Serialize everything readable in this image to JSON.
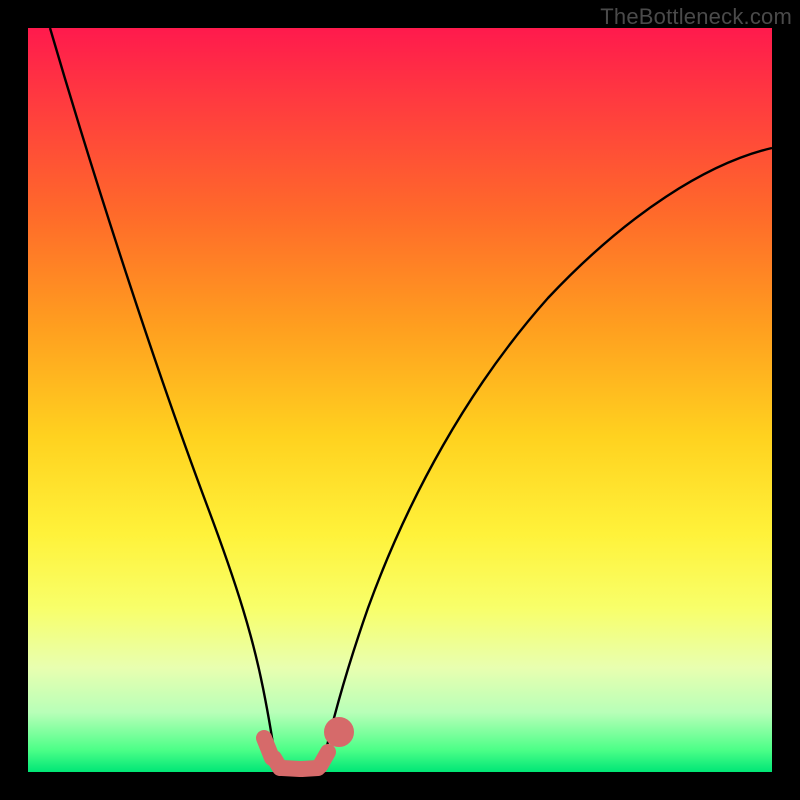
{
  "watermark": "TheBottleneck.com",
  "chart_data": {
    "type": "line",
    "title": "",
    "xlabel": "",
    "ylabel": "",
    "xlim": [
      0,
      100
    ],
    "ylim": [
      0,
      100
    ],
    "grid": false,
    "legend": false,
    "series": [
      {
        "name": "left-branch",
        "x": [
          3,
          6,
          10,
          14,
          18,
          22,
          25,
          27,
          29,
          31,
          32.5
        ],
        "y": [
          100,
          84,
          66,
          50,
          36,
          22,
          12,
          6,
          2.5,
          0.8,
          0
        ]
      },
      {
        "name": "valley-floor",
        "x": [
          32.5,
          34,
          36,
          38,
          39.5
        ],
        "y": [
          0,
          0,
          0,
          0,
          0
        ]
      },
      {
        "name": "right-branch",
        "x": [
          39.5,
          41,
          44,
          48,
          54,
          62,
          72,
          84,
          96,
          100
        ],
        "y": [
          0,
          1,
          4,
          10,
          20,
          33,
          48,
          62,
          74,
          78
        ]
      },
      {
        "name": "valley-markers",
        "x": [
          31.5,
          32.5,
          34,
          36,
          38,
          39.5,
          41.5
        ],
        "y": [
          2,
          0.5,
          0,
          0,
          0,
          0.5,
          3
        ]
      }
    ]
  }
}
